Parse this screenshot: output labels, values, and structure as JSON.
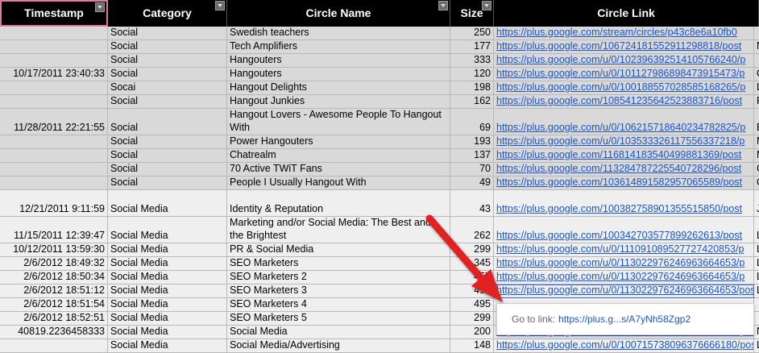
{
  "headers": {
    "timestamp": "Timestamp",
    "category": "Category",
    "circle_name": "Circle Name",
    "size": "Size",
    "circle_link": "Circle Link"
  },
  "rows": [
    {
      "ts": "",
      "cat": "Social",
      "name": "Swedish teachers",
      "size": "250",
      "link": "https://plus.google.com/stream/circles/p43c8e6a10fb0",
      "x": "",
      "h": 17,
      "tone": "g"
    },
    {
      "ts": "",
      "cat": "Social",
      "name": "Tech Amplifiers",
      "size": "177",
      "link": "https://plus.google.com/106724181552911298818/post",
      "x": "N",
      "h": 17,
      "tone": "g"
    },
    {
      "ts": "",
      "cat": "Social",
      "name": "Hangouters",
      "size": "333",
      "link": "https://plus.google.com/u/0/102396392514105766240/p",
      "x": "",
      "h": 17,
      "tone": "g"
    },
    {
      "ts": "10/17/2011 23:40:33",
      "cat": "Social",
      "name": "Hangouters",
      "size": "120",
      "link": "https://plus.google.com/u/0/101127986898473915473/p",
      "x": "C",
      "h": 17,
      "tone": "g"
    },
    {
      "ts": "",
      "cat": "Socai",
      "name": "Hangout Delights",
      "size": "198",
      "link": "https://plus.google.com/u/0/100188557028585168265/p",
      "x": "L",
      "h": 17,
      "tone": "g"
    },
    {
      "ts": "",
      "cat": "Social",
      "name": "Hangout Junkies",
      "size": "162",
      "link": "https://plus.google.com/108541235642523883716/post",
      "x": "P",
      "h": 17,
      "tone": "g"
    },
    {
      "ts": "11/28/2011 22:21:55",
      "cat": "Social",
      "name": "Hangout Lovers - Awesome People To Hangout With",
      "size": "69",
      "link": "https://plus.google.com/u/0/106215718640234782825/p",
      "x": "B",
      "h": 33,
      "tone": "g",
      "wrap": true
    },
    {
      "ts": "",
      "cat": "Social",
      "name": "Power Hangouters",
      "size": "193",
      "link": "https://plus.google.com/u/0/103533326117556337218/p",
      "x": "M",
      "h": 17,
      "tone": "g"
    },
    {
      "ts": "",
      "cat": "Social",
      "name": "Chatrealm",
      "size": "137",
      "link": "https://plus.google.com/116814183540499881369/post",
      "x": "M",
      "h": 17,
      "tone": "g"
    },
    {
      "ts": "",
      "cat": "Social",
      "name": "70 Active TWiT Fans",
      "size": "70",
      "link": "https://plus.google.com/113284787225540728296/post",
      "x": "C",
      "h": 17,
      "tone": "g"
    },
    {
      "ts": "",
      "cat": "Social",
      "name": "People I Usually Hangout With",
      "size": "49",
      "link": "https://plus.google.com/103614891582957065589/post",
      "x": "C",
      "h": 17,
      "tone": "g"
    },
    {
      "ts": "12/21/2011 9:11:59",
      "cat": "Social Media",
      "name": "Identity & Reputation",
      "size": "43",
      "link": "https://plus.google.com/100382758901355515850/post",
      "x": "J",
      "h": 33,
      "tone": "w"
    },
    {
      "ts": "11/15/2011 12:39:47",
      "cat": "Social Media",
      "name": "Marketing and/or Social Media: The Best and the Brightest",
      "size": "262",
      "link": "https://plus.google.com/100342703577899262613/post",
      "x": "L",
      "h": 33,
      "tone": "w",
      "wrap": true
    },
    {
      "ts": "10/12/2011 13:59:30",
      "cat": "Social Media",
      "name": "PR & Social Media",
      "size": "299",
      "link": "https://plus.google.com/u/0/111091089527727420853/p",
      "x": "L",
      "h": 17,
      "tone": "w"
    },
    {
      "ts": "2/6/2012 18:49:32",
      "cat": "Social Media",
      "name": "SEO Marketers",
      "size": "345",
      "link": "https://plus.google.com/u/0/113022976246963664653/p",
      "x": "L",
      "h": 17,
      "tone": "w"
    },
    {
      "ts": "2/6/2012 18:50:34",
      "cat": "Social Media",
      "name": "SEO Marketers 2",
      "size": "457",
      "link": "https://plus.google.com/u/0/113022976246963664653/p",
      "x": "L",
      "h": 17,
      "tone": "w"
    },
    {
      "ts": "2/6/2012 18:51:12",
      "cat": "Social Media",
      "name": "SEO Marketers 3",
      "size": "498",
      "link": "https://plus.google.com/u/0/113022976246963664653/post",
      "x": "L",
      "h": 17,
      "tone": "w",
      "active": true
    },
    {
      "ts": "2/6/2012 18:51:54",
      "cat": "Social Media",
      "name": "SEO Marketers 4",
      "size": "495",
      "link": "",
      "x": "",
      "h": 17,
      "tone": "w"
    },
    {
      "ts": "2/6/2012 18:52:51",
      "cat": "Social Media",
      "name": "SEO Marketers 5",
      "size": "299",
      "link": "",
      "x": "",
      "h": 17,
      "tone": "w"
    },
    {
      "ts": "40819.2236458333",
      "cat": "Social Media",
      "name": "Social Media",
      "size": "200",
      "link": "https://plus.google.com/u/0/109182240100500005035/post",
      "x": "N",
      "h": 17,
      "tone": "w"
    },
    {
      "ts": "",
      "cat": "Social Media",
      "name": "Social Media/Advertising",
      "size": "148",
      "link": "https://plus.google.com/u/0/100715738096376666180/post",
      "x": "L",
      "h": 17,
      "tone": "w"
    }
  ],
  "tooltip": {
    "label": "Go to link:",
    "link": "https://plus.g...s/A7yNh58Zgp2"
  },
  "colors": {
    "header_bg": "#000000",
    "link": "#1a55cc",
    "arrow": "#e02020"
  }
}
